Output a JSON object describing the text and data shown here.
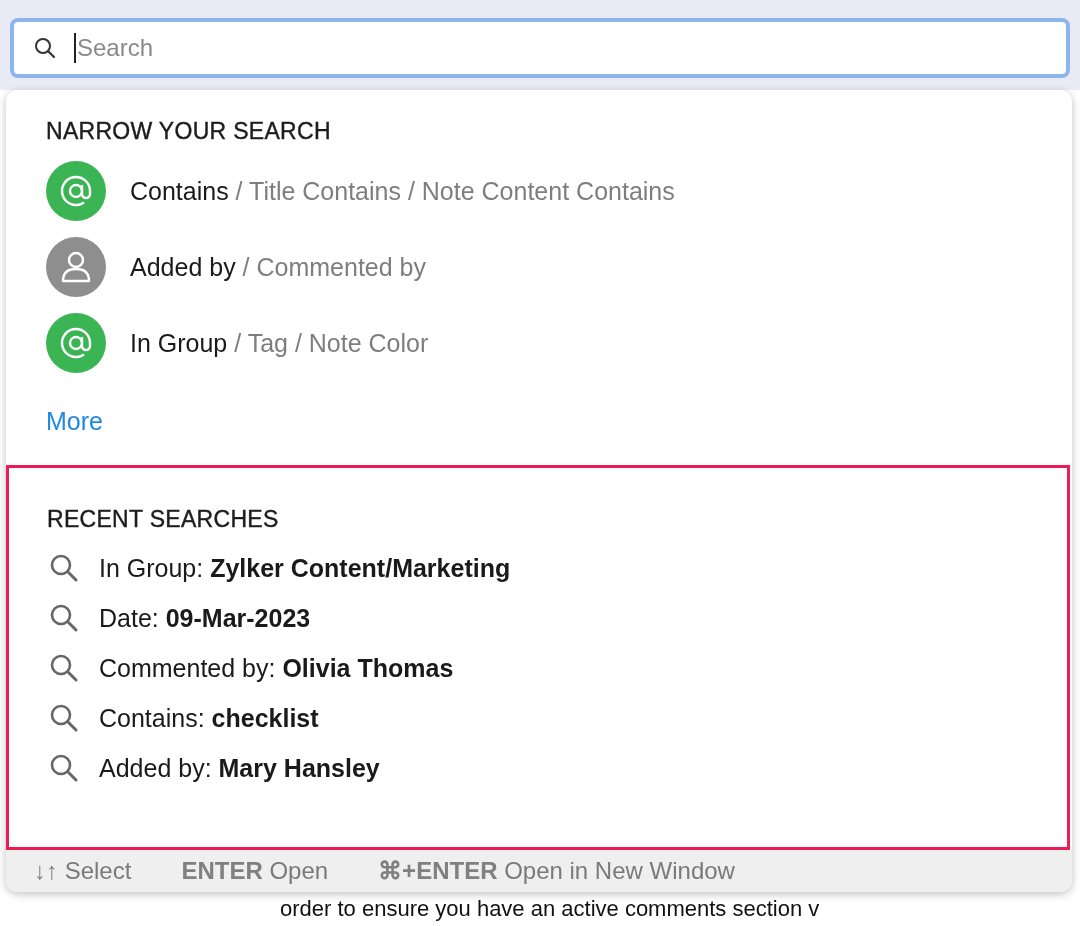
{
  "search": {
    "placeholder": "Search"
  },
  "narrow": {
    "heading": "NARROW YOUR SEARCH",
    "items": [
      {
        "kind": "at",
        "color": "#3bb554",
        "label": "Contains",
        "alternatives": " / Title Contains / Note Content Contains"
      },
      {
        "kind": "person",
        "color": "#8e8e8e",
        "label": "Added by",
        "alternatives": " / Commented by"
      },
      {
        "kind": "at",
        "color": "#3bb554",
        "label": "In Group",
        "alternatives": " / Tag / Note Color"
      }
    ],
    "more": "More"
  },
  "recent": {
    "heading": "RECENT SEARCHES",
    "items": [
      {
        "label": "In Group: ",
        "value": "Zylker Content/Marketing"
      },
      {
        "label": "Date: ",
        "value": "09-Mar-2023"
      },
      {
        "label": "Commented by: ",
        "value": "Olivia Thomas"
      },
      {
        "label": "Contains: ",
        "value": "checklist"
      },
      {
        "label": "Added by: ",
        "value": "Mary Hansley"
      }
    ]
  },
  "footer": [
    {
      "key": "↓↑",
      "action": " Select"
    },
    {
      "key": "ENTER",
      "action": " Open"
    },
    {
      "key": "⌘+ENTER",
      "action": " Open in New Window"
    }
  ],
  "background_text": "order to ensure you have an active comments section v"
}
